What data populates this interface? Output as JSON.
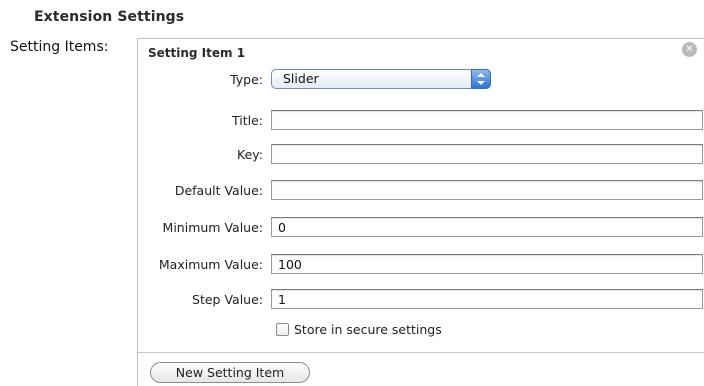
{
  "section": {
    "title": "Extension Settings"
  },
  "sidebar_label": "Setting Items:",
  "item": {
    "title": "Setting Item 1",
    "close_icon": "close-circle-icon",
    "fields": {
      "type": {
        "label": "Type:",
        "value": "Slider"
      },
      "title": {
        "label": "Title:",
        "value": ""
      },
      "key": {
        "label": "Key:",
        "value": ""
      },
      "default_value": {
        "label": "Default Value:",
        "value": ""
      },
      "minimum_value": {
        "label": "Minimum Value:",
        "value": "0"
      },
      "maximum_value": {
        "label": "Maximum Value:",
        "value": "100"
      },
      "step_value": {
        "label": "Step Value:",
        "value": "1"
      }
    },
    "secure_checkbox": {
      "label": "Store in secure settings",
      "checked": false
    }
  },
  "new_item_button": "New Setting Item",
  "colors": {
    "select_accent": "#2f74d8",
    "border": "#9a9a9a"
  }
}
